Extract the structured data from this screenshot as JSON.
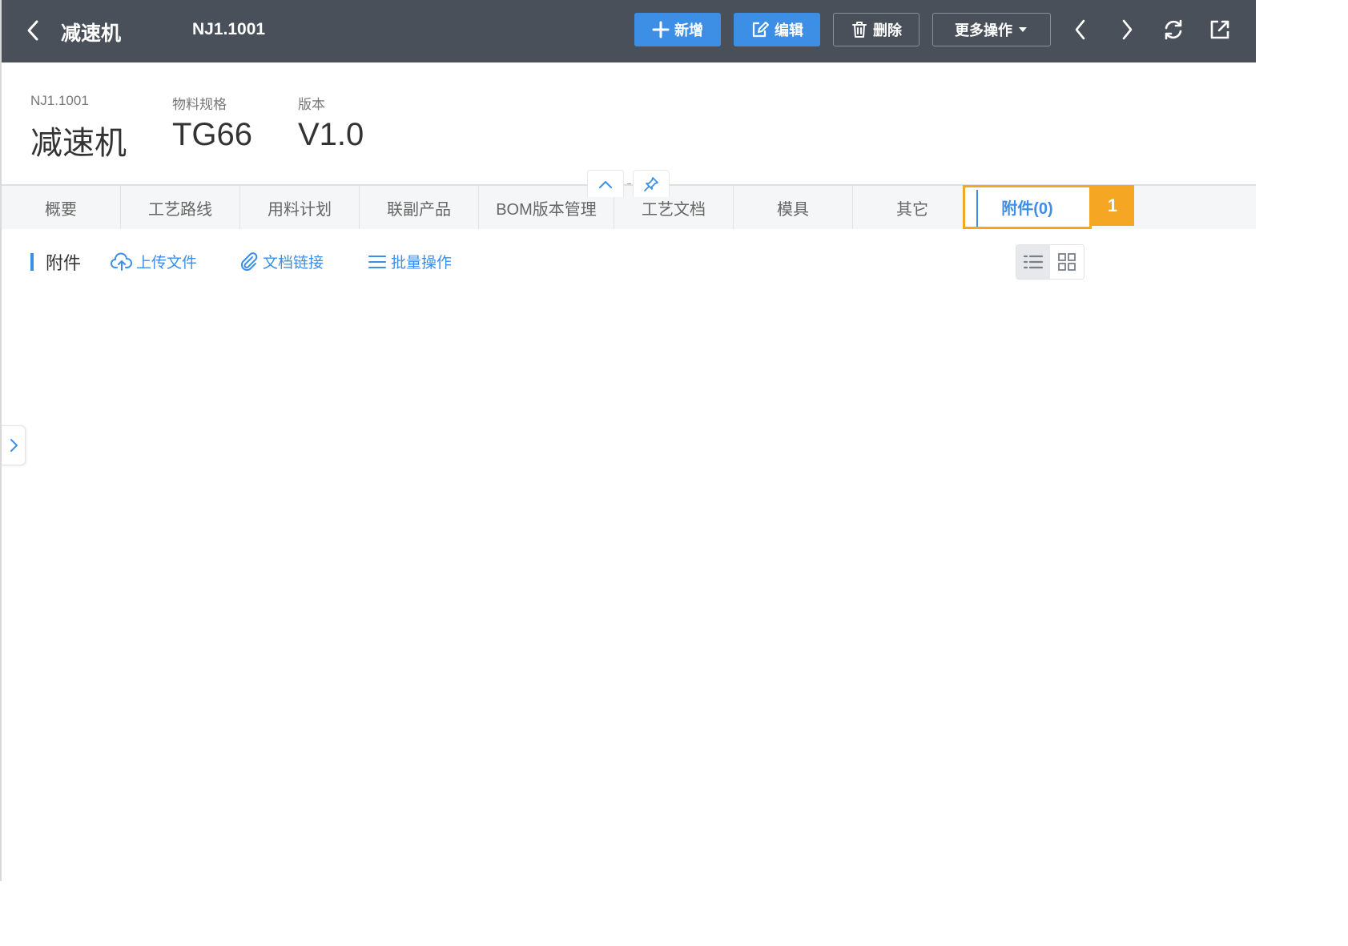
{
  "header": {
    "title": "减速机",
    "code": "NJ1.1001",
    "buttons": {
      "add": "新增",
      "edit": "编辑",
      "delete": "删除",
      "more": "更多操作"
    }
  },
  "summary": {
    "fields": [
      {
        "label": "NJ1.1001",
        "value": "减速机"
      },
      {
        "label": "物料规格",
        "value": "TG66"
      },
      {
        "label": "版本",
        "value": "V1.0"
      }
    ]
  },
  "tabs": [
    {
      "label": "概要"
    },
    {
      "label": "工艺路线"
    },
    {
      "label": "用料计划"
    },
    {
      "label": "联副产品"
    },
    {
      "label": "BOM版本管理"
    },
    {
      "label": "工艺文档"
    },
    {
      "label": "模具"
    },
    {
      "label": "其它"
    },
    {
      "label": "附件(0)",
      "active": true
    }
  ],
  "step_marker": "1",
  "attachments": {
    "title": "附件",
    "actions": {
      "upload": "上传文件",
      "link": "文档链接",
      "batch": "批量操作"
    },
    "view_mode": "list"
  },
  "icons": [
    "chevron-left-icon",
    "plus-icon",
    "edit-icon",
    "trash-icon",
    "caret-down-icon",
    "chevron-left-icon",
    "chevron-right-icon",
    "refresh-icon",
    "external-link-icon",
    "chevron-up-icon",
    "pin-icon",
    "cloud-upload-icon",
    "paperclip-icon",
    "menu-lines-icon",
    "list-view-icon",
    "grid-view-icon",
    "chevron-right-icon"
  ],
  "colors": {
    "header_bg": "#4a5059",
    "primary": "#3d8fe6",
    "highlight": "#f5a623",
    "tab_bg": "#f5f6f7"
  }
}
